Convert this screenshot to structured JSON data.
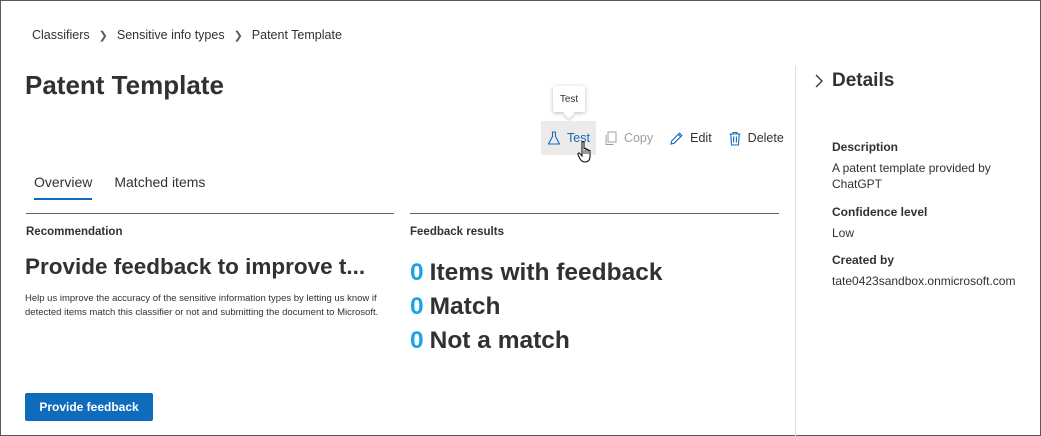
{
  "breadcrumb": {
    "items": [
      "Classifiers",
      "Sensitive info types",
      "Patent Template"
    ]
  },
  "page": {
    "title": "Patent Template"
  },
  "tooltip": {
    "text": "Test"
  },
  "toolbar": {
    "test_label": "Test",
    "copy_label": "Copy",
    "edit_label": "Edit",
    "delete_label": "Delete"
  },
  "tabs": [
    {
      "label": "Overview",
      "active": true
    },
    {
      "label": "Matched items",
      "active": false
    }
  ],
  "recommendation": {
    "section_label": "Recommendation",
    "title": "Provide feedback to improve t...",
    "description": "Help us improve the accuracy of the sensitive information types by letting us know if detected items match this classifier or not and submitting the document to Microsoft.",
    "button_label": "Provide feedback"
  },
  "feedback": {
    "section_label": "Feedback results",
    "rows": [
      {
        "count": "0",
        "label": "Items with feedback"
      },
      {
        "count": "0",
        "label": "Match"
      },
      {
        "count": "0",
        "label": "Not a match"
      }
    ]
  },
  "details": {
    "title": "Details",
    "fields": [
      {
        "label": "Description",
        "value": "A patent template provided by ChatGPT"
      },
      {
        "label": "Confidence level",
        "value": "Low"
      },
      {
        "label": "Created by",
        "value": "tate0423sandbox.onmicrosoft.com"
      }
    ]
  },
  "colors": {
    "accent": "#0f6cbd",
    "count": "#1aa3e8",
    "text": "#323130"
  },
  "icons": [
    "chevron-right-icon",
    "flask-icon",
    "copy-icon",
    "pencil-icon",
    "trash-icon",
    "hand-cursor-icon"
  ]
}
